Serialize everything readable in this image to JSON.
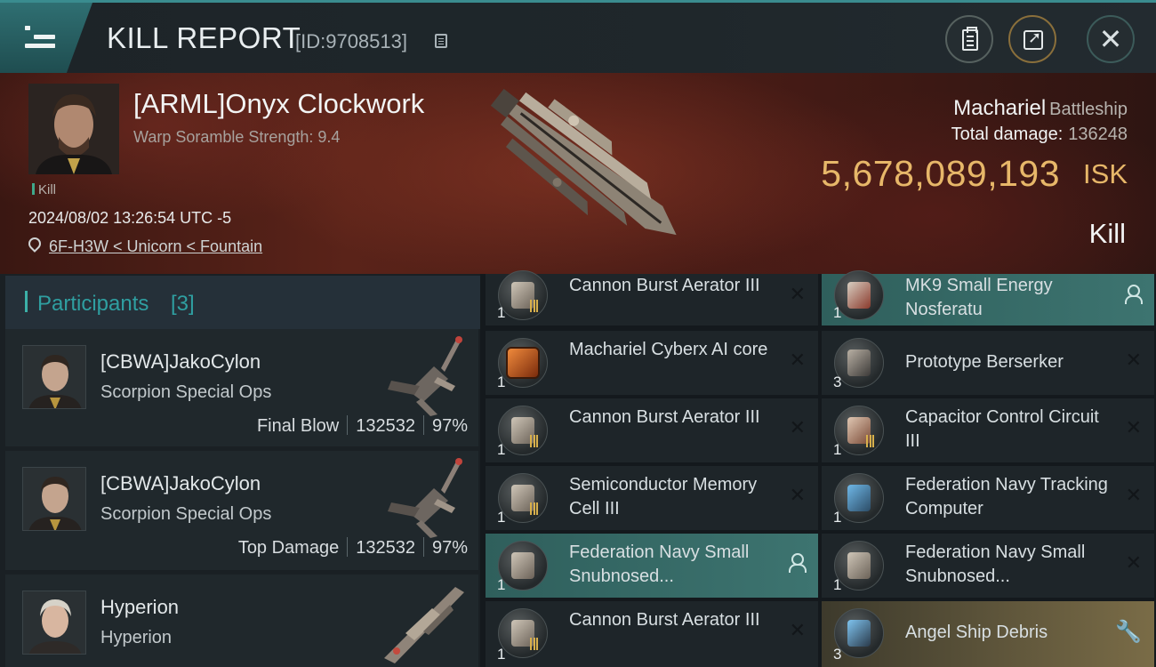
{
  "header": {
    "title": "KILL REPORT",
    "report_id": "[ID:9708513]"
  },
  "victim": {
    "name": "[ARML]Onyx Clockwork",
    "warp_scramble": "Warp Soramble Strength: 9.4",
    "tag": "Kill",
    "timestamp": "2024/08/02 13:26:54 UTC -5",
    "location": "6F-H3W < Unicorn < Fountain",
    "ship": "Machariel",
    "ship_class": "Battleship",
    "total_damage_label": "Total damage:",
    "total_damage": "136248",
    "isk_value": "5,678,089,193",
    "isk_unit": "ISK",
    "status": "Kill"
  },
  "participants": {
    "title": "Participants",
    "count": "[3]",
    "list": [
      {
        "name": "[CBWA]JakoCylon",
        "ship": "Scorpion Special Ops",
        "role": "Final Blow",
        "damage": "132532",
        "percent": "97%"
      },
      {
        "name": "[CBWA]JakoCylon",
        "ship": "Scorpion Special Ops",
        "role": "Top Damage",
        "damage": "132532",
        "percent": "97%"
      },
      {
        "name": "Hyperion",
        "ship": "Hyperion"
      }
    ]
  },
  "items_left": [
    {
      "name": "Cannon Burst Aerator III",
      "qty": "1"
    },
    {
      "name": "Machariel Cyberx AI core",
      "qty": "1"
    },
    {
      "name": "Cannon Burst Aerator III",
      "qty": "1"
    },
    {
      "name": "Semiconductor Memory Cell III",
      "qty": "1"
    },
    {
      "name": "Federation Navy Small Snubnosed...",
      "qty": "1"
    },
    {
      "name": "Cannon Burst Aerator III",
      "qty": "1"
    }
  ],
  "items_right": [
    {
      "name": "MK9 Small Energy Nosferatu",
      "qty": "1"
    },
    {
      "name": "Prototype  Berserker",
      "qty": "3"
    },
    {
      "name": "Capacitor Control Circuit III",
      "qty": "1"
    },
    {
      "name": "Federation Navy Tracking Computer",
      "qty": "1"
    },
    {
      "name": "Federation Navy Small Snubnosed...",
      "qty": "1"
    },
    {
      "name": "Angel Ship Debris",
      "qty": "3"
    }
  ],
  "colors": {
    "accent_teal": "#2f9fa1",
    "isk_gold": "#e7b769",
    "dropped_highlight": "#3d7470",
    "salvage_gold": "#7a6c47"
  }
}
